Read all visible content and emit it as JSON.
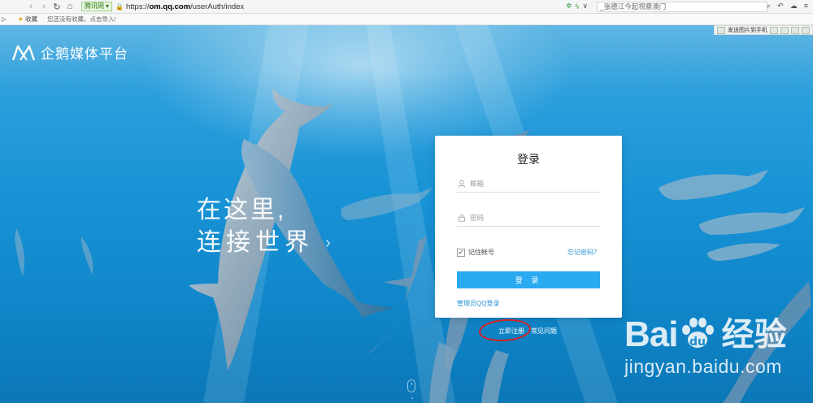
{
  "browser": {
    "site_badge": "腾讯网",
    "url_scheme": "https://",
    "url_host": "om.qq.com",
    "url_path": "/userAuth/index",
    "search_text": "_张德江今起视察澳门",
    "bookmark_label": "收藏",
    "bookmark_hint": "您还没有收藏，点击导入!",
    "ext_send_label": "发送图片到手机"
  },
  "header": {
    "logo_text": "企鹅媒体平台"
  },
  "hero": {
    "slogan_line1": "在这里,",
    "slogan_line2": "连接世界",
    "slogan_chevron": "›"
  },
  "login": {
    "title": "登录",
    "email_placeholder": "邮箱",
    "password_placeholder": "密码",
    "remember_label": "记住帐号",
    "remember_checked": true,
    "forgot_label": "忘记密码？",
    "submit_label": "登 录",
    "qq_login_label": "管理员QQ登录"
  },
  "links": {
    "register_label": "立即注册",
    "faq_label": "常见问题"
  },
  "watermark": {
    "brand_left": "Bai",
    "brand_right": "经验",
    "url": "jingyan.baidu.com"
  },
  "colors": {
    "accent": "#2aaaf1",
    "link": "#2b92d4",
    "annotation_circle": "#d32424"
  }
}
